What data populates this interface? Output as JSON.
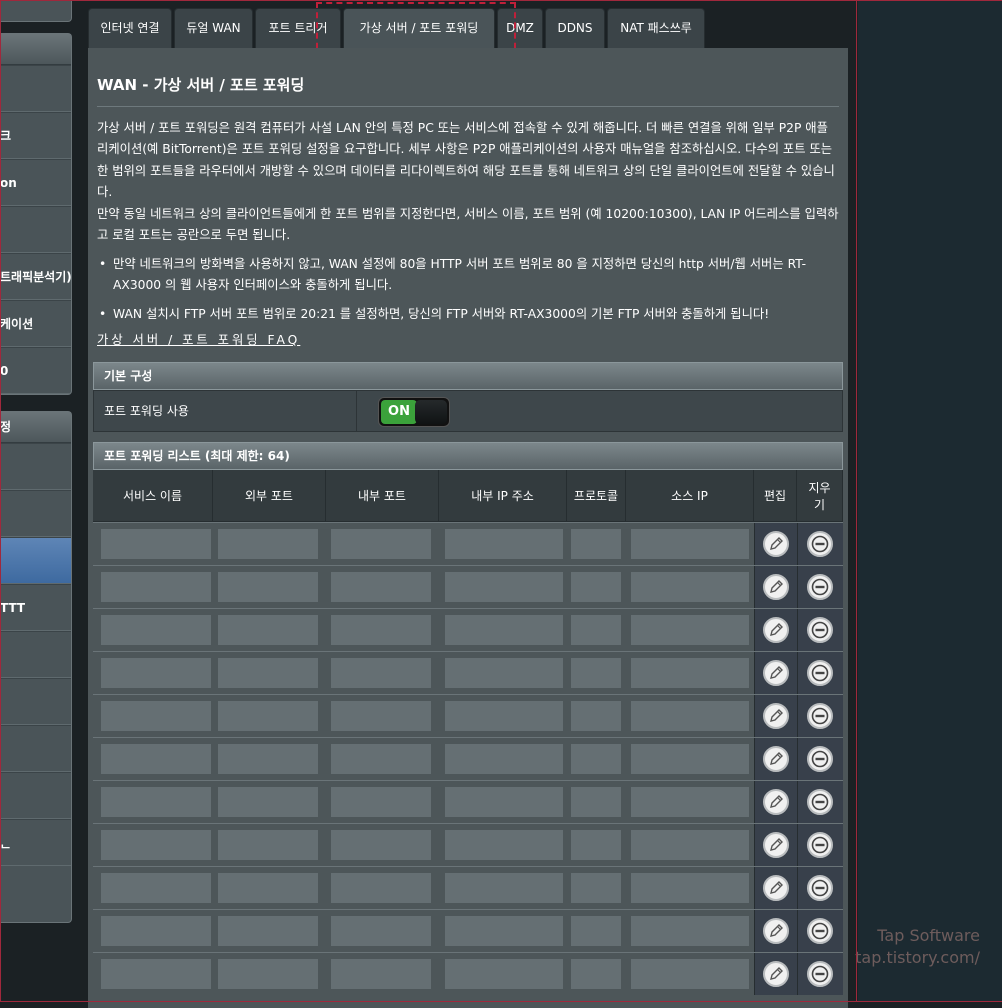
{
  "sidebar": {
    "card1_items": [
      "",
      "크",
      "on",
      "",
      "트래픽분석기)",
      "케이션",
      "0"
    ],
    "card2_header": "정",
    "card2_items": [
      "",
      "",
      "",
      "TTT",
      "",
      "",
      "",
      "",
      "ᆫ"
    ]
  },
  "tabs": [
    {
      "label": "인터넷 연결"
    },
    {
      "label": "듀얼 WAN"
    },
    {
      "label": "포트 트리거"
    },
    {
      "label": "가상 서버 / 포트 포워딩"
    },
    {
      "label": "DMZ"
    },
    {
      "label": "DDNS"
    },
    {
      "label": "NAT 패스쓰루"
    }
  ],
  "page": {
    "title": "WAN - 가상 서버 / 포트 포워딩",
    "desc1": "가상 서버 / 포트 포워딩은 원격 컴퓨터가 사설 LAN 안의 특정 PC 또는 서비스에 접속할 수 있게 해줍니다. 더 빠른 연결을 위해 일부 P2P 애플리케이션(예 BitTorrent)은 포트 포워딩 설정을 요구합니다. 세부 사항은 P2P 애플리케이션의 사용자 매뉴얼을 참조하십시오. 다수의 포트 또는 한 범위의 포트들을 라우터에서 개방할 수 있으며 데이터를 리다이렉트하여 해당 포트를 통해 네트워크 상의 단일 클라이언트에 전달할 수 있습니다.",
    "desc2": "만약 동일 네트워크 상의 클라이언트들에게 한 포트 범위를 지정한다면, 서비스 이름, 포트 범위 (예 10200:10300), LAN IP 어드레스를 입력하고 로컬 포트는 공란으로 두면 됩니다.",
    "bullet1": "만약 네트워크의 방화벽을 사용하지 않고, WAN 설정에 80을 HTTP 서버 포트 범위로 80 을 지정하면 당신의 http 서버/웹 서버는 RT-AX3000 의 웹 사용자 인터페이스와 충돌하게 됩니다.",
    "bullet2": "WAN 설치시 FTP 서버 포트 범위로 20:21 를 설정하면, 당신의 FTP 서버와 RT-AX3000의 기본 FTP 서버와 충돌하게 됩니다!",
    "faq_link": "가상 서버 / 포트 포워딩 FAQ"
  },
  "basic_config": {
    "header": "기본 구성",
    "enable_label": "포트 포워딩 사용",
    "toggle_state": "ON"
  },
  "forward_list": {
    "header": "포트 포워딩 리스트 (최대 제한: 64)",
    "columns": [
      "서비스 이름",
      "외부 포트",
      "내부 포트",
      "내부 IP 주소",
      "프로토콜",
      "소스 IP",
      "편집",
      "지우기"
    ],
    "row_count": 11
  },
  "watermark": {
    "line1": "Tap Software",
    "line2": "tap.tistory.com/"
  }
}
